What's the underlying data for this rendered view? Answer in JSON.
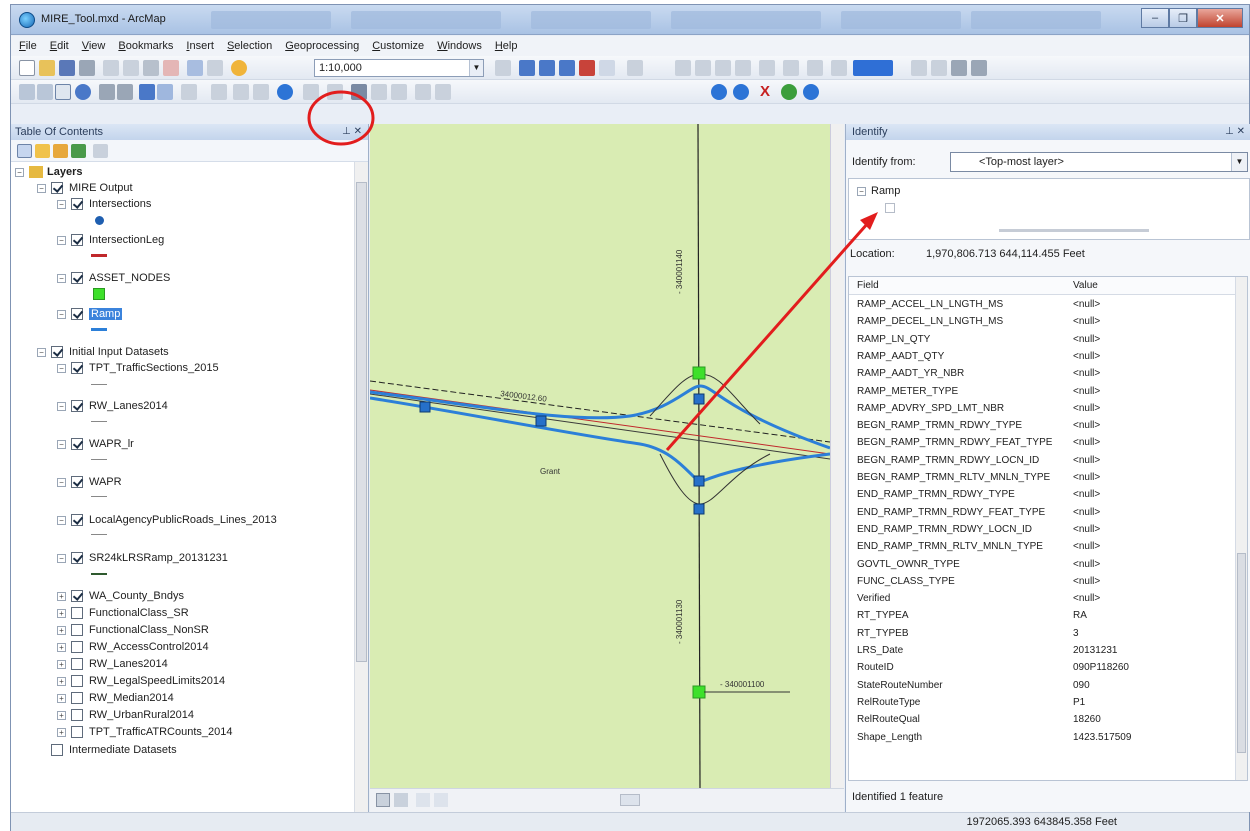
{
  "window": {
    "title": "MIRE_Tool.mxd - ArcMap"
  },
  "menu": [
    "File",
    "Edit",
    "View",
    "Bookmarks",
    "Insert",
    "Selection",
    "Geoprocessing",
    "Customize",
    "Windows",
    "Help"
  ],
  "toolbar": {
    "scale": "1:10,000"
  },
  "toc": {
    "title": "Table Of Contents",
    "layers_label": "Layers",
    "groups": [
      {
        "name": "MIRE Output",
        "checked": true
      },
      {
        "name": "Initial Input Datasets",
        "checked": true
      }
    ],
    "mire_layers": [
      "Intersections",
      "IntersectionLeg",
      "ASSET_NODES",
      "Ramp"
    ],
    "input_layers": [
      "TPT_TrafficSections_2015",
      "RW_Lanes2014",
      "WAPR_lr",
      "WAPR",
      "LocalAgencyPublicRoads_Lines_2013",
      "SR24kLRSRamp_20131231",
      "WA_County_Bndys",
      "FunctionalClass_SR",
      "FunctionalClass_NonSR",
      "RW_AccessControl2014",
      "RW_Lanes2014",
      "RW_LegalSpeedLimits2014",
      "RW_Median2014",
      "RW_UrbanRural2014",
      "TPT_TrafficATRCounts_2014"
    ],
    "intermediate": "Intermediate Datasets"
  },
  "map": {
    "labels": [
      "- 340001140",
      "- 340001130",
      "- 340001100",
      "34000012.60",
      "Grant"
    ],
    "colors": {
      "background": "#d9ecb3",
      "ramp": "#2c7fd8",
      "node": "#3ee02b",
      "intersection": "#1f5fb0",
      "leg": "#c0282b"
    }
  },
  "identify": {
    "title": "Identify",
    "from_label": "Identify from:",
    "from_value": "<Top-most layer>",
    "tree_root": "Ramp",
    "location_label": "Location:",
    "location_value": "1,970,806.713  644,114.455 Feet",
    "col_field": "Field",
    "col_value": "Value",
    "rows": [
      {
        "f": "RAMP_ACCEL_LN_LNGTH_MS",
        "v": "<null>"
      },
      {
        "f": "RAMP_DECEL_LN_LNGTH_MS",
        "v": "<null>"
      },
      {
        "f": "RAMP_LN_QTY",
        "v": "<null>"
      },
      {
        "f": "RAMP_AADT_QTY",
        "v": "<null>"
      },
      {
        "f": "RAMP_AADT_YR_NBR",
        "v": "<null>"
      },
      {
        "f": "RAMP_METER_TYPE",
        "v": "<null>"
      },
      {
        "f": "RAMP_ADVRY_SPD_LMT_NBR",
        "v": "<null>"
      },
      {
        "f": "BEGN_RAMP_TRMN_RDWY_TYPE",
        "v": "<null>"
      },
      {
        "f": "BEGN_RAMP_TRMN_RDWY_FEAT_TYPE",
        "v": "<null>"
      },
      {
        "f": "BEGN_RAMP_TRMN_RDWY_LOCN_ID",
        "v": "<null>"
      },
      {
        "f": "BEGN_RAMP_TRMN_RLTV_MNLN_TYPE",
        "v": "<null>"
      },
      {
        "f": "END_RAMP_TRMN_RDWY_TYPE",
        "v": "<null>"
      },
      {
        "f": "END_RAMP_TRMN_RDWY_FEAT_TYPE",
        "v": "<null>"
      },
      {
        "f": "END_RAMP_TRMN_RDWY_LOCN_ID",
        "v": "<null>"
      },
      {
        "f": "END_RAMP_TRMN_RLTV_MNLN_TYPE",
        "v": "<null>"
      },
      {
        "f": "GOVTL_OWNR_TYPE",
        "v": "<null>"
      },
      {
        "f": "FUNC_CLASS_TYPE",
        "v": "<null>"
      },
      {
        "f": "Verified",
        "v": "<null>"
      },
      {
        "f": "RT_TYPEA",
        "v": "RA"
      },
      {
        "f": "RT_TYPEB",
        "v": "3"
      },
      {
        "f": "LRS_Date",
        "v": "20131231"
      },
      {
        "f": "RouteID",
        "v": "090P118260"
      },
      {
        "f": "StateRouteNumber",
        "v": "090"
      },
      {
        "f": "RelRouteType",
        "v": "P1"
      },
      {
        "f": "RelRouteQual",
        "v": "18260"
      },
      {
        "f": "Shape_Length",
        "v": "1423.517509"
      }
    ],
    "status": "Identified 1 feature"
  },
  "statusbar": {
    "coords": "1972065.393  643845.358 Feet"
  }
}
